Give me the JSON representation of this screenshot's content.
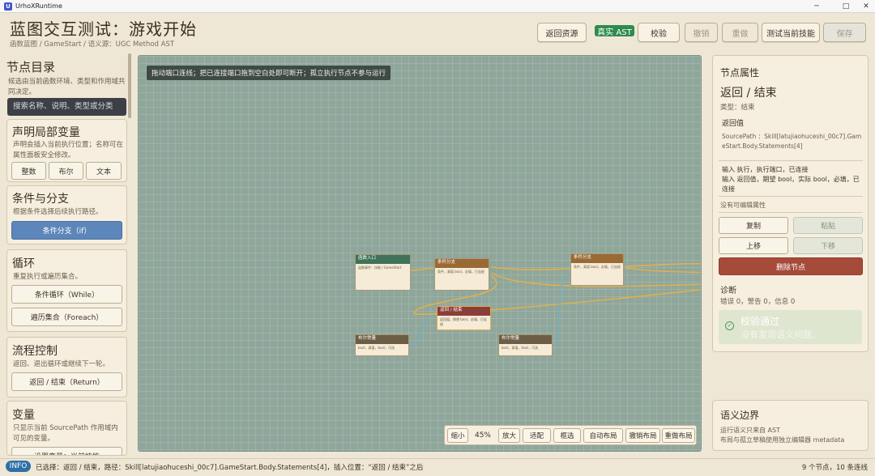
{
  "window": {
    "title": "UrhoXRuntime",
    "app_icon": "U"
  },
  "header": {
    "title": "蓝图交互测试：游戏开始",
    "subtitle": "函数蓝图 / GameStart / 语义源：UGC Method AST",
    "buttons": {
      "back": "返回资源",
      "validate": "校验",
      "undo": "撤销",
      "redo": "重做",
      "test_skill": "测试当前技能",
      "save": "保存"
    },
    "ast_badge": "真实 AST"
  },
  "sidebar": {
    "title": "节点目录",
    "desc": "候选由当前函数环境、类型和作用域共同决定。",
    "search_placeholder": "搜索名称、说明、类型或分类",
    "sections": {
      "locals": {
        "title": "声明局部变量",
        "desc": "声明会插入当前执行位置；名称可在属性面板安全修改。",
        "buttons": [
          "整数",
          "布尔",
          "文本"
        ]
      },
      "branch": {
        "title": "条件与分支",
        "desc": "根据条件选择后续执行路径。",
        "button": "条件分支（if）"
      },
      "loop": {
        "title": "循环",
        "desc": "重复执行或遍历集合。",
        "buttons": [
          "条件循环（While）",
          "遍历集合（Foreach）"
        ]
      },
      "flow": {
        "title": "流程控制",
        "desc": "返回、退出循环或继续下一轮。",
        "button": "返回 / 结束（Return）"
      },
      "vars": {
        "title": "变量",
        "desc": "只显示当前 SourcePath 作用域内可见的变量。",
        "button": "设置变量：当前技能"
      }
    }
  },
  "canvas": {
    "hint": "拖动端口连线；把已连接端口拖到空白处即可断开；孤立执行节点不参与运行",
    "nodes": {
      "entry": {
        "title": "函数入口",
        "sub": "执行开始",
        "body": "函数事件：技能 / GameStart"
      },
      "branch1": {
        "title": "条件分支",
        "sub": "执行分支",
        "body": "条件，真值 bool，必填，已连接"
      },
      "branch2": {
        "title": "条件分支",
        "sub": "执行分支",
        "body": "条件，真值 bool，必填，已连接"
      },
      "ret": {
        "title": "返回 / 结束",
        "sub": "已选中",
        "body": "返回值，期望 bool，必填，已连接"
      },
      "bool1": {
        "title": "布尔常量",
        "sub": "常量",
        "body": "bool，真值，bool，可选"
      },
      "bool2": {
        "title": "布尔常量",
        "sub": "常量",
        "body": "bool，真值，bool，可选"
      }
    },
    "zoom_bar": {
      "shrink": "缩小",
      "level": "45%",
      "enlarge": "放大",
      "fit": "适配",
      "select": "框选",
      "auto_layout": "自动布局",
      "undo_layout": "撤销布局",
      "redo_layout": "重做布局"
    }
  },
  "inspector": {
    "title": "节点属性",
    "node_name": "返回 / 结束",
    "type_label": "类型：结束",
    "return_label": "返回值",
    "source_path": "SourcePath ：Skill[latujiaohuceshi_00c7].GameStart.Body.Statements[4]",
    "ports": "输入 执行，执行端口，已连接\n输入 返回值，期望 bool，实际 bool，必填，已连接",
    "no_editable": "没有可编辑属性",
    "buttons": {
      "copy": "复制",
      "paste": "粘贴",
      "move_up": "上移",
      "move_down": "下移",
      "delete": "删除节点"
    },
    "diagnostics_title": "诊断",
    "diagnostics_counts": "错误 0，警告 0，信息 0",
    "valid_title": "校验通过",
    "valid_desc": "没有发现语义问题。"
  },
  "semantic": {
    "title": "语义边界",
    "desc": "运行语义只来自 AST\n布局与孤立草稿使用独立编辑器 metadata"
  },
  "status": {
    "level": "INFO",
    "message": "已选择：返回 / 结束，路径：Skill[latujiaohuceshi_00c7].GameStart.Body.Statements[4]，插入位置：“返回 / 结束”之后",
    "counts": "9 个节点，10 条连线"
  },
  "colors": {
    "accent_green": "#2f8a4e",
    "danger": "#a64a3a",
    "branch_blue": "#5d86ba",
    "canvas": "#8fa69b",
    "wire": "#e0b04c"
  }
}
